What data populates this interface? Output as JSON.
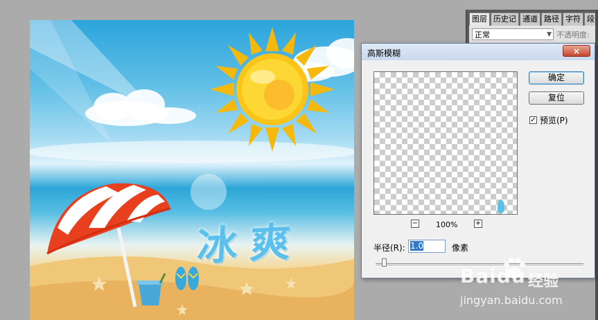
{
  "layers_panel": {
    "tabs": [
      "图层",
      "历史记",
      "通道",
      "路径",
      "字符",
      "段落"
    ],
    "active_tab": 0,
    "blend_mode": "正常",
    "opacity_label": "不透明度:"
  },
  "dialog": {
    "title": "高斯模糊",
    "close_label": "×",
    "ok_label": "确定",
    "reset_label": "复位",
    "preview_label": "预览(P)",
    "preview_checked": true,
    "zoom_out_label": "−",
    "zoom_in_label": "+",
    "zoom_level": "100%",
    "radius_label": "半径(R):",
    "radius_value": "1.0",
    "unit_label": "像素"
  },
  "canvas": {
    "text": "冰爽"
  },
  "watermark": {
    "brand": "Baidu",
    "brand_cn": "经验",
    "url": "jingyan.baidu.com"
  },
  "colors": {
    "workspace": "#ababab",
    "dialog_bg": "#f0f0f0",
    "close_red": "#c7432c",
    "accent_blue": "#3379c9",
    "art_text": "#5bc1ec"
  }
}
